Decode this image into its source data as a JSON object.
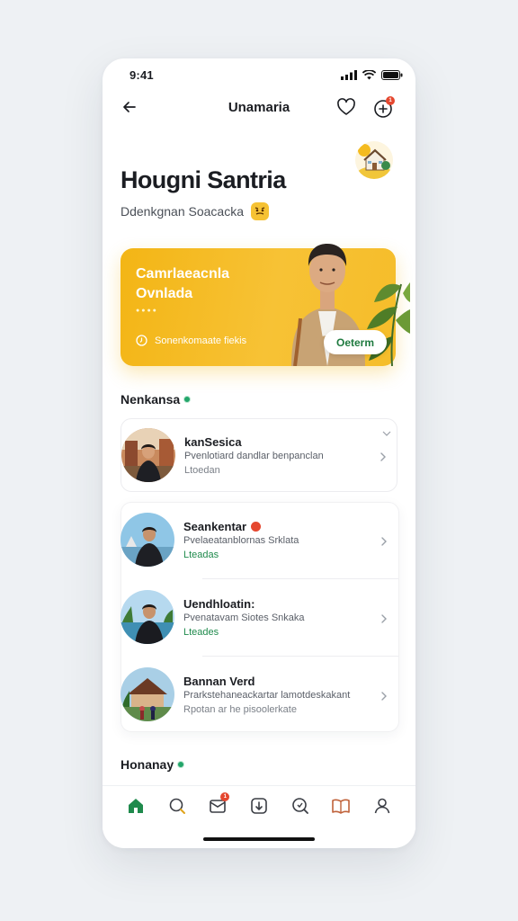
{
  "status_bar": {
    "time": "9:41"
  },
  "app_bar": {
    "title": "Unamaria",
    "back_icon": "arrow-left-icon",
    "heart_icon": "heart-icon",
    "add_icon": "plus-circle-icon",
    "notification_count": "1"
  },
  "profile": {
    "headline": "Hougni Santria",
    "subline": "Ddenkgnan Soacacka"
  },
  "promo": {
    "line1": "Camrlaeacnla",
    "line2": "Ovnlada",
    "meta": "Sonenkomaate fiekis",
    "cta_label": "Oeterm",
    "accent": "#f3b515"
  },
  "section1": {
    "title": "Nenkansa"
  },
  "listings": [
    {
      "name": "kanSesica",
      "desc": "Pvenlotiard dandlar benpanclan",
      "tag": "Ltoedan",
      "tag_color": "gray",
      "has_badge": false
    },
    {
      "name": "Seankentar",
      "desc": "Pvelaeatanblornas Srklata",
      "tag": "Lteadas",
      "tag_color": "green",
      "has_badge": true
    },
    {
      "name": "Uendhloatin:",
      "desc": "Pvenatavam Siotes Snkaka",
      "tag": "Lteades",
      "tag_color": "green",
      "has_badge": false
    },
    {
      "name": "Bannan Verd",
      "desc": "Prarkstehaneackartar lamotdeskakant",
      "tag": "Rpotan ar he pisoolerkate",
      "tag_color": "gray",
      "has_badge": false
    }
  ],
  "section2": {
    "title": "Honanay"
  },
  "tabbar": {
    "items": [
      "home-icon",
      "search-icon",
      "inbox-icon",
      "add-square-icon",
      "explore-icon",
      "book-icon",
      "profile-icon"
    ],
    "inbox_badge": "1",
    "active_color": "#1f8a4c"
  }
}
